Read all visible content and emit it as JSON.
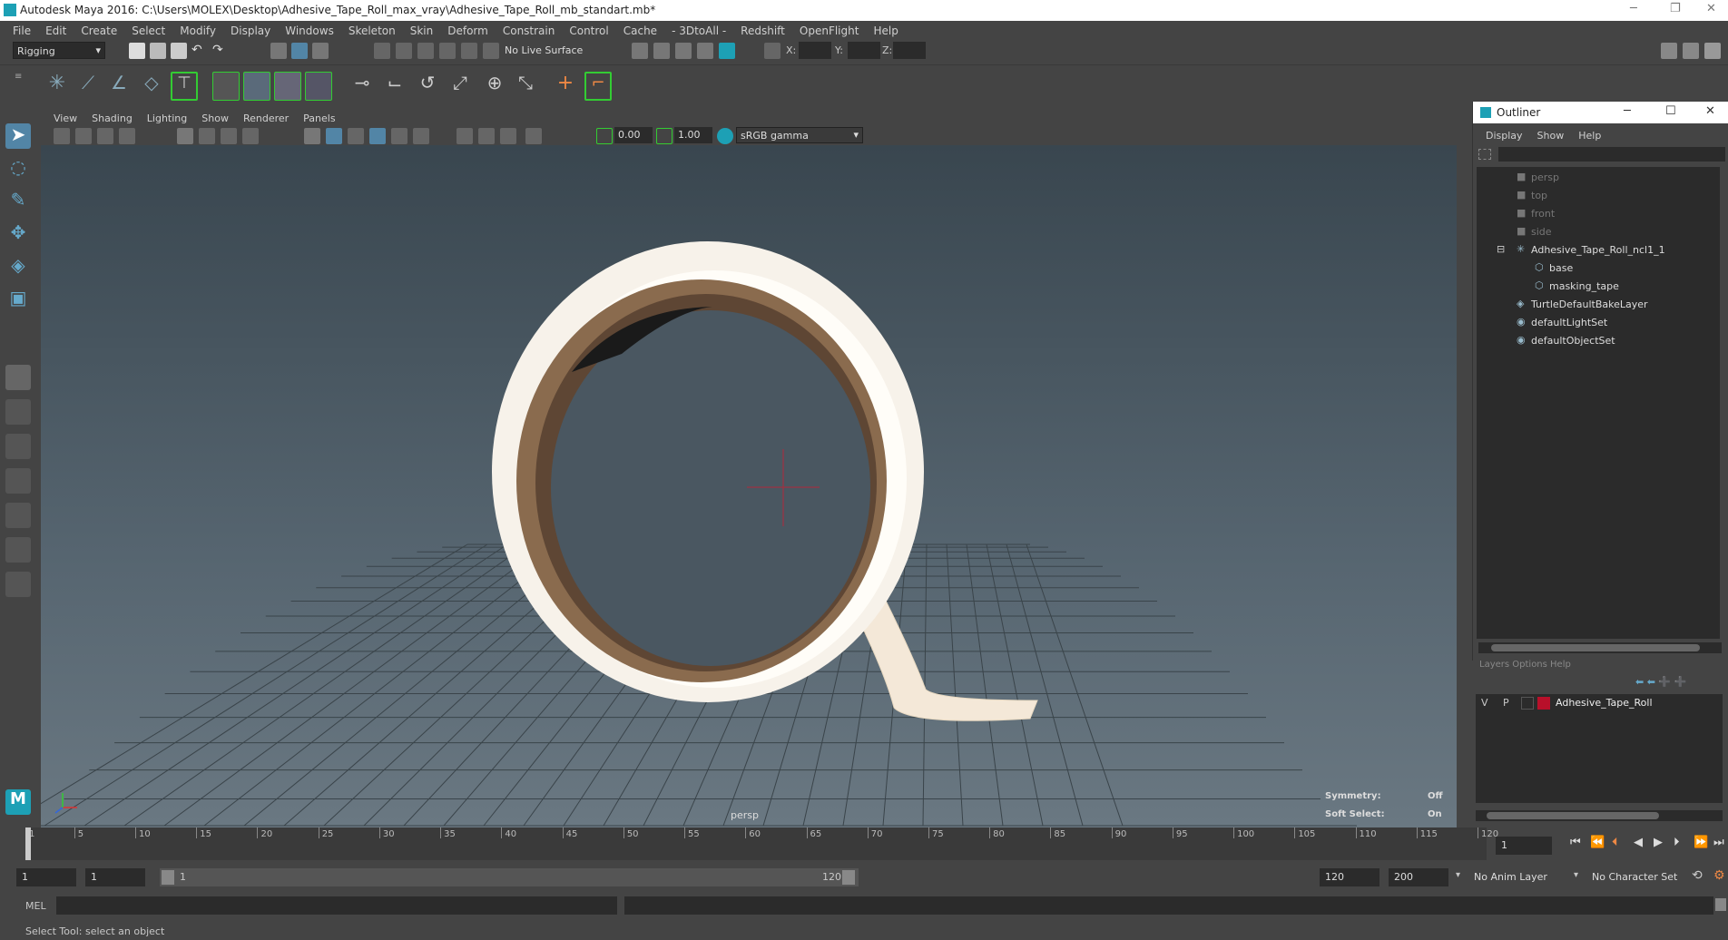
{
  "title_bar": {
    "title": "Autodesk Maya 2016: C:\\Users\\MOLEX\\Desktop\\Adhesive_Tape_Roll_max_vray\\Adhesive_Tape_Roll_mb_standart.mb*",
    "minimize": "─",
    "restore": "❐",
    "close": "✕"
  },
  "menu_bar": {
    "items": [
      "File",
      "Edit",
      "Create",
      "Select",
      "Modify",
      "Display",
      "Windows",
      "Skeleton",
      "Skin",
      "Deform",
      "Constrain",
      "Control",
      "Cache",
      "- 3DtoAll -",
      "Redshift",
      "OpenFlight",
      "Help"
    ]
  },
  "status_line": {
    "menu_set": "Rigging",
    "live_surface": "No Live Surface",
    "x_label": "X:",
    "y_label": "Y:",
    "z_label": "Z:"
  },
  "viewport": {
    "menus": [
      "View",
      "Shading",
      "Lighting",
      "Show",
      "Renderer",
      "Panels"
    ],
    "exposure": "0.00",
    "gamma": "1.00",
    "color_space": "sRGB gamma",
    "camera_label": "persp",
    "hud": {
      "symmetry_label": "Symmetry:",
      "symmetry_value": "Off",
      "soft_select_label": "Soft Select:",
      "soft_select_value": "On"
    }
  },
  "outliner": {
    "title": "Outliner",
    "menus": [
      "Display",
      "Show",
      "Help"
    ],
    "items": [
      {
        "label": "persp",
        "dim": true,
        "icon": "camera-icon"
      },
      {
        "label": "top",
        "dim": true,
        "icon": "camera-icon"
      },
      {
        "label": "front",
        "dim": true,
        "icon": "camera-icon"
      },
      {
        "label": "side",
        "dim": true,
        "icon": "camera-icon"
      },
      {
        "label": "Adhesive_Tape_Roll_ncl1_1",
        "dim": false,
        "icon": "group-icon",
        "expanded": true
      },
      {
        "label": "base",
        "dim": false,
        "icon": "mesh-icon",
        "child": true
      },
      {
        "label": "masking_tape",
        "dim": false,
        "icon": "mesh-icon",
        "child": true
      },
      {
        "label": "TurtleDefaultBakeLayer",
        "dim": false,
        "icon": "layer-icon"
      },
      {
        "label": "defaultLightSet",
        "dim": false,
        "icon": "set-icon"
      },
      {
        "label": "defaultObjectSet",
        "dim": false,
        "icon": "set-icon"
      }
    ]
  },
  "layer_editor": {
    "tabs_partial": "Layers  Options  Help",
    "layer": {
      "visible": "V",
      "playback": "P",
      "name": "Adhesive_Tape_Roll",
      "color": "#b8102a"
    }
  },
  "timeline": {
    "ticks": [
      "1",
      "5",
      "10",
      "15",
      "20",
      "25",
      "30",
      "35",
      "40",
      "45",
      "50",
      "55",
      "60",
      "65",
      "70",
      "75",
      "80",
      "85",
      "90",
      "95",
      "100",
      "105",
      "110",
      "115",
      "120"
    ],
    "current_frame": "1"
  },
  "range": {
    "start_frame": "1",
    "start_range": "1",
    "slider_start": "1",
    "slider_end": "120",
    "end_range": "120",
    "end_frame": "200",
    "anim_layer": "No Anim Layer",
    "character_set": "No Character Set"
  },
  "command_line": {
    "mel_label": "MEL"
  },
  "help_line": {
    "text": "Select Tool: select an object"
  },
  "colors": {
    "accent": "#1da0b5",
    "selected": "#5285a6",
    "background": "#444444"
  }
}
